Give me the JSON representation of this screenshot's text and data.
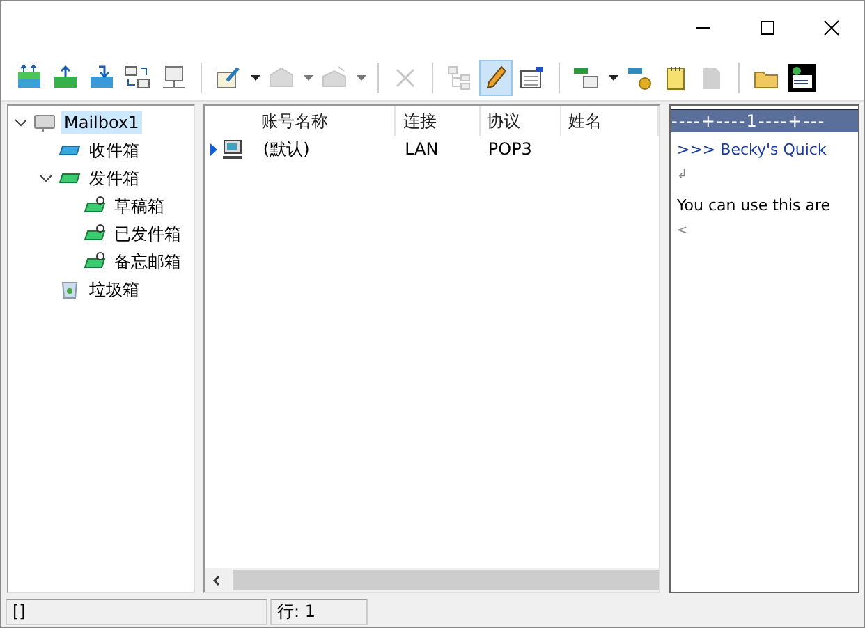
{
  "toolbar": [
    {
      "kind": "button",
      "disabled": false,
      "pressed": false,
      "dropdown": false
    },
    {
      "kind": "button",
      "disabled": false,
      "pressed": false,
      "dropdown": false
    },
    {
      "kind": "button",
      "disabled": false,
      "pressed": false,
      "dropdown": false
    },
    {
      "kind": "button",
      "disabled": false,
      "pressed": false,
      "dropdown": false
    },
    {
      "kind": "button",
      "disabled": false,
      "pressed": false,
      "dropdown": false
    },
    {
      "kind": "separator"
    },
    {
      "kind": "button",
      "disabled": false,
      "pressed": false,
      "dropdown": true
    },
    {
      "kind": "button",
      "disabled": true,
      "pressed": false,
      "dropdown": true
    },
    {
      "kind": "button",
      "disabled": true,
      "pressed": false,
      "dropdown": true
    },
    {
      "kind": "separator"
    },
    {
      "kind": "button",
      "disabled": true,
      "pressed": false,
      "dropdown": false
    },
    {
      "kind": "separator"
    },
    {
      "kind": "button",
      "disabled": true,
      "pressed": false,
      "dropdown": false
    },
    {
      "kind": "button",
      "disabled": false,
      "pressed": true,
      "dropdown": false
    },
    {
      "kind": "button",
      "disabled": false,
      "pressed": false,
      "dropdown": false
    },
    {
      "kind": "separator"
    },
    {
      "kind": "button",
      "disabled": false,
      "pressed": false,
      "dropdown": true
    },
    {
      "kind": "button",
      "disabled": false,
      "pressed": false,
      "dropdown": false
    },
    {
      "kind": "button",
      "disabled": false,
      "pressed": false,
      "dropdown": false
    },
    {
      "kind": "button",
      "disabled": true,
      "pressed": false,
      "dropdown": false
    },
    {
      "kind": "separator"
    },
    {
      "kind": "button",
      "disabled": false,
      "pressed": false,
      "dropdown": false
    },
    {
      "kind": "button",
      "disabled": false,
      "pressed": false,
      "dropdown": false
    }
  ],
  "tree": [
    {
      "label": "Mailbox1",
      "selected": true,
      "expanded": true,
      "children": [
        {
          "label": "收件箱",
          "selected": false
        },
        {
          "label": "发件箱",
          "selected": false,
          "expanded": true,
          "children": [
            {
              "label": "草稿箱",
              "selected": false
            },
            {
              "label": "已发件箱",
              "selected": false
            },
            {
              "label": "备忘邮箱",
              "selected": false
            }
          ]
        },
        {
          "label": "垃圾箱",
          "selected": false
        }
      ]
    }
  ],
  "table": {
    "columns": [
      "账号名称",
      "连接",
      "协议",
      "姓名"
    ],
    "rows": [
      {
        "current": true,
        "cells": [
          "(默认)",
          "LAN",
          "POP3",
          ""
        ]
      }
    ]
  },
  "preview": {
    "ruler": "----+----1----+---",
    "lines": [
      {
        "kind": "heading",
        "text": ">>> Becky's Quick"
      },
      {
        "kind": "mark",
        "text": "↲"
      },
      {
        "kind": "text",
        "text": "You can use this are"
      },
      {
        "kind": "mark",
        "text": "<"
      }
    ]
  },
  "status_bar": [
    "[]",
    "行: 1"
  ]
}
